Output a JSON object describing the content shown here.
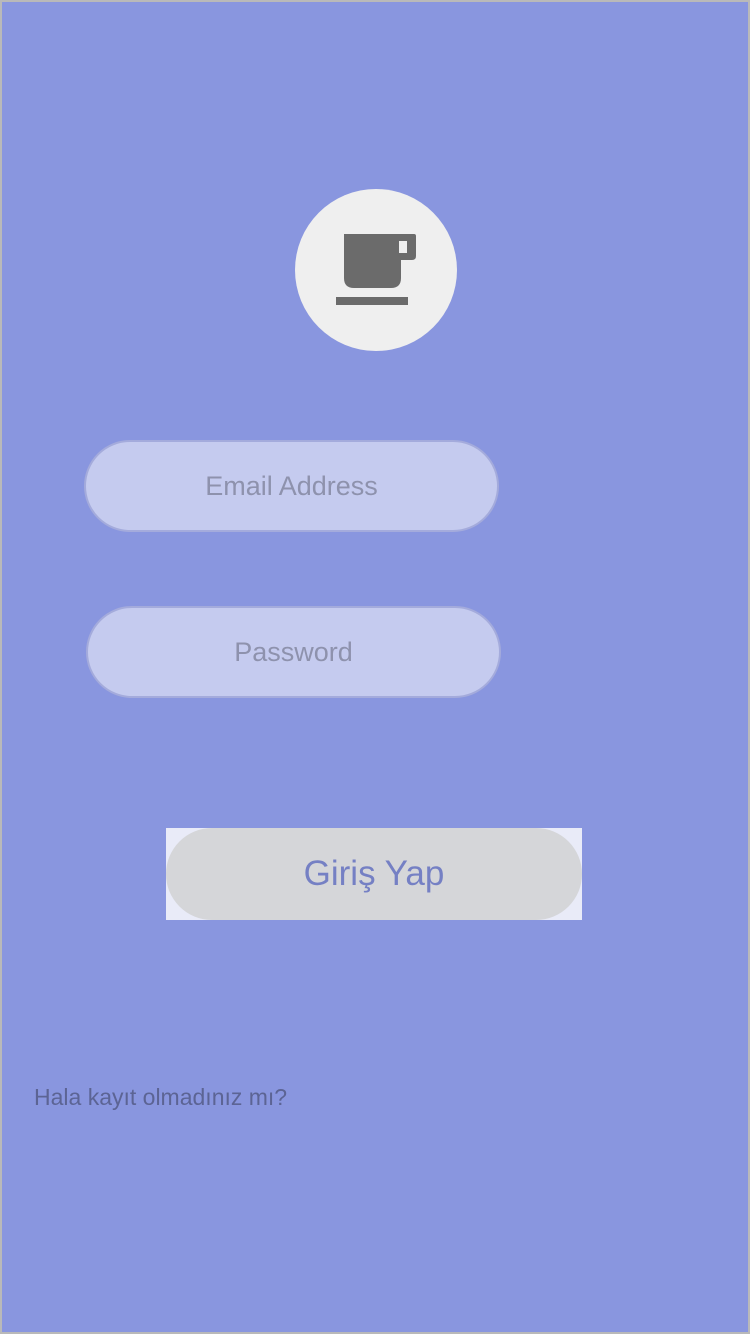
{
  "logo": {
    "icon": "coffee-cup-icon"
  },
  "form": {
    "email_placeholder": "Email Address",
    "password_placeholder": "Password",
    "login_label": "Giriş Yap",
    "register_prompt": "Hala kayıt olmadınız mı?"
  },
  "colors": {
    "background": "#8996df",
    "field_background": "#c5cbef",
    "button_background": "#d5d6d9",
    "button_text": "#7580c4",
    "icon": "#6b6b6b"
  }
}
